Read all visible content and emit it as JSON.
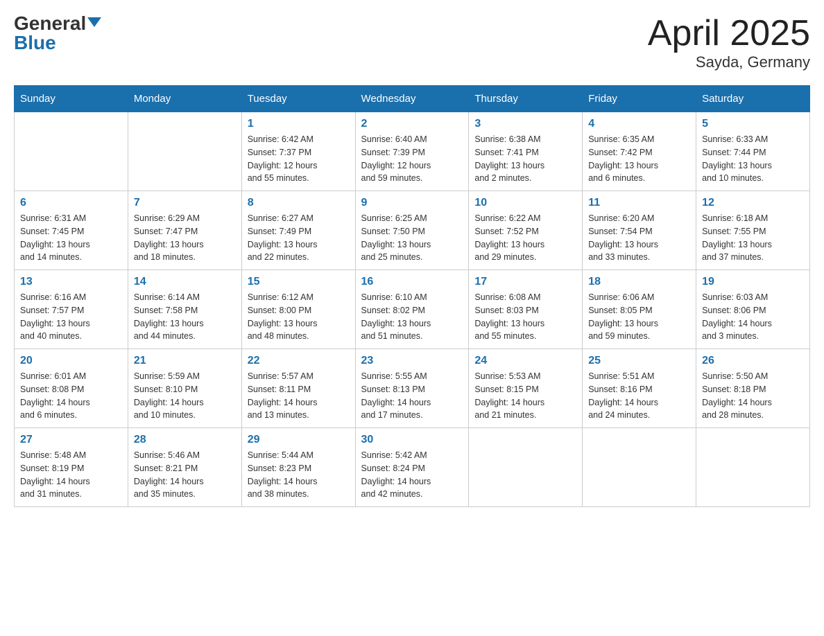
{
  "header": {
    "logo_general": "General",
    "logo_blue": "Blue",
    "title": "April 2025",
    "location": "Sayda, Germany"
  },
  "days_of_week": [
    "Sunday",
    "Monday",
    "Tuesday",
    "Wednesday",
    "Thursday",
    "Friday",
    "Saturday"
  ],
  "weeks": [
    [
      {
        "day": "",
        "info": ""
      },
      {
        "day": "",
        "info": ""
      },
      {
        "day": "1",
        "info": "Sunrise: 6:42 AM\nSunset: 7:37 PM\nDaylight: 12 hours\nand 55 minutes."
      },
      {
        "day": "2",
        "info": "Sunrise: 6:40 AM\nSunset: 7:39 PM\nDaylight: 12 hours\nand 59 minutes."
      },
      {
        "day": "3",
        "info": "Sunrise: 6:38 AM\nSunset: 7:41 PM\nDaylight: 13 hours\nand 2 minutes."
      },
      {
        "day": "4",
        "info": "Sunrise: 6:35 AM\nSunset: 7:42 PM\nDaylight: 13 hours\nand 6 minutes."
      },
      {
        "day": "5",
        "info": "Sunrise: 6:33 AM\nSunset: 7:44 PM\nDaylight: 13 hours\nand 10 minutes."
      }
    ],
    [
      {
        "day": "6",
        "info": "Sunrise: 6:31 AM\nSunset: 7:45 PM\nDaylight: 13 hours\nand 14 minutes."
      },
      {
        "day": "7",
        "info": "Sunrise: 6:29 AM\nSunset: 7:47 PM\nDaylight: 13 hours\nand 18 minutes."
      },
      {
        "day": "8",
        "info": "Sunrise: 6:27 AM\nSunset: 7:49 PM\nDaylight: 13 hours\nand 22 minutes."
      },
      {
        "day": "9",
        "info": "Sunrise: 6:25 AM\nSunset: 7:50 PM\nDaylight: 13 hours\nand 25 minutes."
      },
      {
        "day": "10",
        "info": "Sunrise: 6:22 AM\nSunset: 7:52 PM\nDaylight: 13 hours\nand 29 minutes."
      },
      {
        "day": "11",
        "info": "Sunrise: 6:20 AM\nSunset: 7:54 PM\nDaylight: 13 hours\nand 33 minutes."
      },
      {
        "day": "12",
        "info": "Sunrise: 6:18 AM\nSunset: 7:55 PM\nDaylight: 13 hours\nand 37 minutes."
      }
    ],
    [
      {
        "day": "13",
        "info": "Sunrise: 6:16 AM\nSunset: 7:57 PM\nDaylight: 13 hours\nand 40 minutes."
      },
      {
        "day": "14",
        "info": "Sunrise: 6:14 AM\nSunset: 7:58 PM\nDaylight: 13 hours\nand 44 minutes."
      },
      {
        "day": "15",
        "info": "Sunrise: 6:12 AM\nSunset: 8:00 PM\nDaylight: 13 hours\nand 48 minutes."
      },
      {
        "day": "16",
        "info": "Sunrise: 6:10 AM\nSunset: 8:02 PM\nDaylight: 13 hours\nand 51 minutes."
      },
      {
        "day": "17",
        "info": "Sunrise: 6:08 AM\nSunset: 8:03 PM\nDaylight: 13 hours\nand 55 minutes."
      },
      {
        "day": "18",
        "info": "Sunrise: 6:06 AM\nSunset: 8:05 PM\nDaylight: 13 hours\nand 59 minutes."
      },
      {
        "day": "19",
        "info": "Sunrise: 6:03 AM\nSunset: 8:06 PM\nDaylight: 14 hours\nand 3 minutes."
      }
    ],
    [
      {
        "day": "20",
        "info": "Sunrise: 6:01 AM\nSunset: 8:08 PM\nDaylight: 14 hours\nand 6 minutes."
      },
      {
        "day": "21",
        "info": "Sunrise: 5:59 AM\nSunset: 8:10 PM\nDaylight: 14 hours\nand 10 minutes."
      },
      {
        "day": "22",
        "info": "Sunrise: 5:57 AM\nSunset: 8:11 PM\nDaylight: 14 hours\nand 13 minutes."
      },
      {
        "day": "23",
        "info": "Sunrise: 5:55 AM\nSunset: 8:13 PM\nDaylight: 14 hours\nand 17 minutes."
      },
      {
        "day": "24",
        "info": "Sunrise: 5:53 AM\nSunset: 8:15 PM\nDaylight: 14 hours\nand 21 minutes."
      },
      {
        "day": "25",
        "info": "Sunrise: 5:51 AM\nSunset: 8:16 PM\nDaylight: 14 hours\nand 24 minutes."
      },
      {
        "day": "26",
        "info": "Sunrise: 5:50 AM\nSunset: 8:18 PM\nDaylight: 14 hours\nand 28 minutes."
      }
    ],
    [
      {
        "day": "27",
        "info": "Sunrise: 5:48 AM\nSunset: 8:19 PM\nDaylight: 14 hours\nand 31 minutes."
      },
      {
        "day": "28",
        "info": "Sunrise: 5:46 AM\nSunset: 8:21 PM\nDaylight: 14 hours\nand 35 minutes."
      },
      {
        "day": "29",
        "info": "Sunrise: 5:44 AM\nSunset: 8:23 PM\nDaylight: 14 hours\nand 38 minutes."
      },
      {
        "day": "30",
        "info": "Sunrise: 5:42 AM\nSunset: 8:24 PM\nDaylight: 14 hours\nand 42 minutes."
      },
      {
        "day": "",
        "info": ""
      },
      {
        "day": "",
        "info": ""
      },
      {
        "day": "",
        "info": ""
      }
    ]
  ]
}
